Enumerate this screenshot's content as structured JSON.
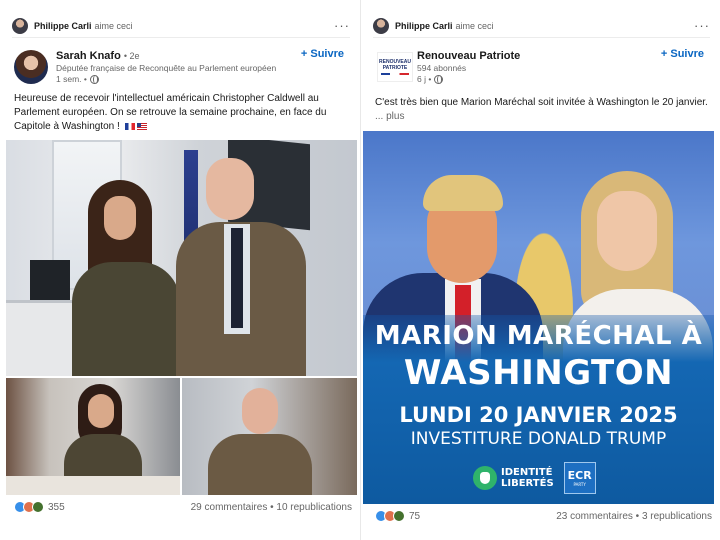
{
  "left_post": {
    "activity": {
      "actor": "Philippe Carli",
      "action": "aime ceci"
    },
    "author": {
      "name": "Sarah Knafo",
      "degree": "• 2e",
      "headline": "Députée française de Reconquête au Parlement européen",
      "time": "1 sem. •"
    },
    "follow_label": "+ Suivre",
    "text": "Heureuse de recevoir l'intellectuel américain Christopher Caldwell au Parlement européen. On se retrouve la semaine prochaine, en face du Capitole à Washington !",
    "reactions_count": "355",
    "comments_reposts": "29 commentaires • 10 republications"
  },
  "right_post": {
    "activity": {
      "actor": "Philippe Carli",
      "action": "aime ceci"
    },
    "author": {
      "name": "Renouveau Patriote",
      "followers": "594 abonnés",
      "time": "6 j •",
      "logo_text": "RENOUVEAU PATRIOTE"
    },
    "follow_label": "+ Suivre",
    "text": "C'est très bien que Marion Maréchal soit invitée à Washington le 20 janvier.",
    "more_label": "... plus",
    "poster": {
      "headline_line1": "MARION MARÉCHAL À",
      "headline_line2": "WASHINGTON",
      "date": "LUNDI 20 JANVIER 2025",
      "subline": "INVESTITURE DONALD TRUMP",
      "party_logo_line1": "IDENTITÉ",
      "party_logo_line2": "LIBERTÉS",
      "group_logo": "ECR",
      "group_logo_sub": "PARTY"
    },
    "reactions_count": "75",
    "comments_reposts": "23 commentaires • 3 republications"
  },
  "colors": {
    "link_blue": "#0a66c2",
    "muted_text": "#666666",
    "like_blue": "#378fe9",
    "love_red": "#df704d",
    "celebrate_green": "#44712e"
  }
}
